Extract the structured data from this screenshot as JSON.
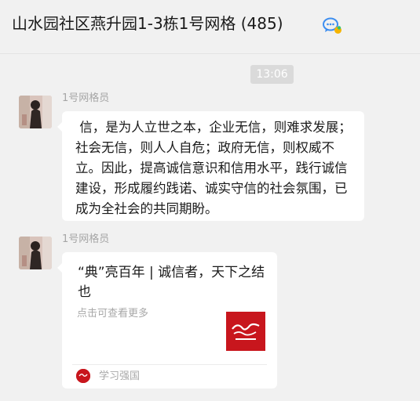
{
  "header": {
    "title": "山水园社区燕升园1-3栋1号网格 (485)",
    "icon": "multi-chat-icon"
  },
  "timestamp": "13:06",
  "messages": [
    {
      "sender": "1号网格员",
      "type": "text",
      "text": " 信，是为人立世之本，企业无信，则难求发展；社会无信，则人人自危；政府无信，则权威不立。因此，提高诚信意识和信用水平，践行诚信建设，形成履约践诺、诚实守信的社会氛围，已成为全社会的共同期盼。"
    },
    {
      "sender": "1号网格员",
      "type": "link-card",
      "card_title": "“典”亮百年 | 诚信者，天下之结也",
      "card_desc": "点击可查看更多",
      "source": "学习强国",
      "thumb_icon": "xuexi-qiangguo-logo",
      "source_icon": "xuexi-qiangguo-small-logo"
    }
  ],
  "colors": {
    "background": "#f1f1f1",
    "bubble": "#ffffff",
    "brand_red": "#c8161d",
    "timestamp_bg": "#dadada"
  }
}
